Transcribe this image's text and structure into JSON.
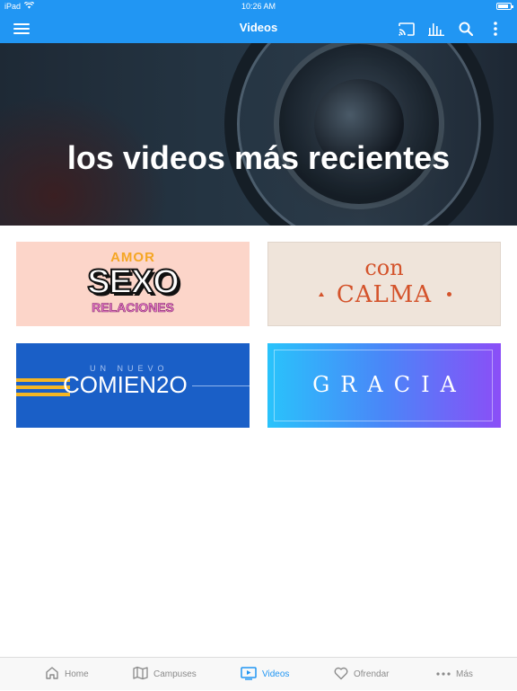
{
  "status": {
    "device": "iPad",
    "time": "10:26 AM",
    "battery_level": 0.85
  },
  "appbar": {
    "title": "Videos"
  },
  "hero": {
    "heading": "los videos más recientes"
  },
  "series": [
    {
      "id": "amor",
      "line1": "AMOR",
      "line2": "SEXO",
      "line3": "RELACIONES"
    },
    {
      "id": "calma",
      "line1": "con",
      "line2": "CALMA"
    },
    {
      "id": "comienzo",
      "line1": "UN NUEVO",
      "line2": "COMIEN2O"
    },
    {
      "id": "gracia",
      "line1": "GRACIA"
    }
  ],
  "tabs": [
    {
      "label": "Home",
      "icon": "home-icon"
    },
    {
      "label": "Campuses",
      "icon": "map-icon"
    },
    {
      "label": "Videos",
      "icon": "video-icon",
      "active": true
    },
    {
      "label": "Ofrendar",
      "icon": "heart-icon"
    },
    {
      "label": "Más",
      "icon": "more-dots-icon"
    }
  ],
  "colors": {
    "accent": "#2196f3",
    "tab_inactive": "#8a8a8a"
  }
}
